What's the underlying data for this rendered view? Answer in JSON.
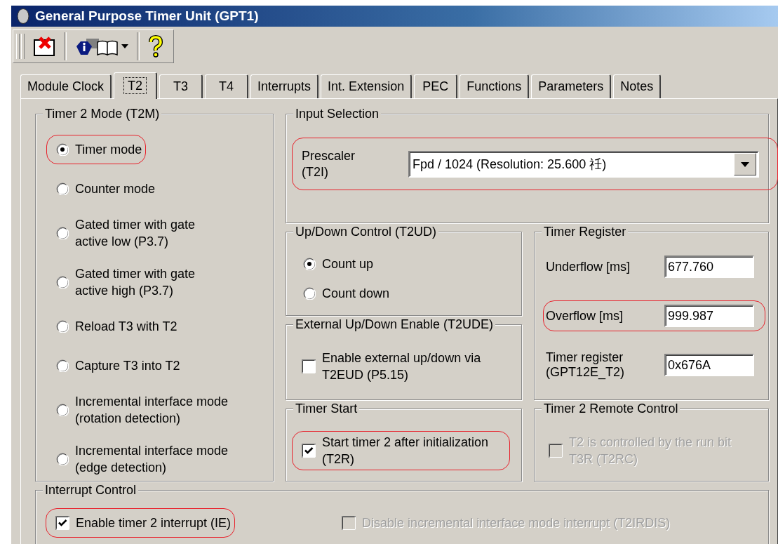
{
  "window": {
    "title": "General Purpose Timer Unit (GPT1)"
  },
  "toolbar": {
    "buttons": [
      {
        "kind": "close"
      },
      {
        "kind": "info"
      },
      {
        "kind": "help"
      }
    ]
  },
  "tabs": [
    {
      "label": "Module Clock",
      "selected": false
    },
    {
      "label": "T2",
      "selected": true
    },
    {
      "label": "T3",
      "selected": false
    },
    {
      "label": "T4",
      "selected": false
    },
    {
      "label": "Interrupts",
      "selected": false
    },
    {
      "label": "Int. Extension",
      "selected": false
    },
    {
      "label": "PEC",
      "selected": false
    },
    {
      "label": "Functions",
      "selected": false
    },
    {
      "label": "Parameters",
      "selected": false
    },
    {
      "label": "Notes",
      "selected": false
    }
  ],
  "timer_mode": {
    "title": "Timer 2 Mode (T2M)",
    "options": [
      {
        "label": "Timer mode",
        "selected": true,
        "highlighted": true
      },
      {
        "label": "Counter mode",
        "selected": false,
        "highlighted": false
      },
      {
        "label": "Gated timer with gate active low (P3.7)",
        "selected": false,
        "highlighted": false
      },
      {
        "label": "Gated timer with gate active high (P3.7)",
        "selected": false,
        "highlighted": false
      },
      {
        "label": "Reload T3 with T2",
        "selected": false,
        "highlighted": false
      },
      {
        "label": "Capture T3 into T2",
        "selected": false,
        "highlighted": false
      },
      {
        "label": "Incremental interface mode (rotation detection)",
        "selected": false,
        "highlighted": false
      },
      {
        "label": "Incremental interface mode (edge detection)",
        "selected": false,
        "highlighted": false
      }
    ]
  },
  "input_selection": {
    "title": "Input Selection",
    "prescaler": {
      "label": "Prescaler (T2I)",
      "value": "Fpd / 1024 (Resolution: 25.600 祍)",
      "highlighted": true
    }
  },
  "up_down_control": {
    "title": "Up/Down Control (T2UD)",
    "options": [
      {
        "label": "Count up",
        "selected": true,
        "highlighted": false
      },
      {
        "label": "Count down",
        "selected": false,
        "highlighted": false
      }
    ]
  },
  "timer_register": {
    "title": "Timer Register",
    "fields": [
      {
        "label": "Underflow [ms]",
        "value": "677.760",
        "highlighted": false
      },
      {
        "label": "Overflow [ms]",
        "value": "999.987",
        "highlighted": true
      },
      {
        "label": "Timer register (GPT12E_T2)",
        "value": "0x676A",
        "highlighted": false
      }
    ]
  },
  "external_up_down": {
    "title": "External Up/Down Enable (T2UDE)",
    "checks": [
      {
        "label": "Enable external up/down via T2EUD (P5.15)",
        "checked": false,
        "disabled": false,
        "highlighted": false
      }
    ]
  },
  "timer_start": {
    "title": "Timer Start",
    "checks": [
      {
        "label": "Start timer 2 after initialization (T2R)",
        "checked": true,
        "disabled": false,
        "highlighted": true
      }
    ]
  },
  "remote_control": {
    "title": "Timer 2 Remote Control",
    "checks": [
      {
        "label": "T2 is controlled by the run bit T3R (T2RC)",
        "checked": false,
        "disabled": true,
        "highlighted": false
      }
    ]
  },
  "interrupt_control": {
    "title": "Interrupt Control",
    "checks": [
      {
        "label": "Enable timer 2 interrupt (IE)",
        "checked": true,
        "disabled": false,
        "highlighted": true
      },
      {
        "label": "Disable incremental interface mode interrupt (T2IRDIS)",
        "checked": false,
        "disabled": true,
        "highlighted": false
      }
    ]
  }
}
